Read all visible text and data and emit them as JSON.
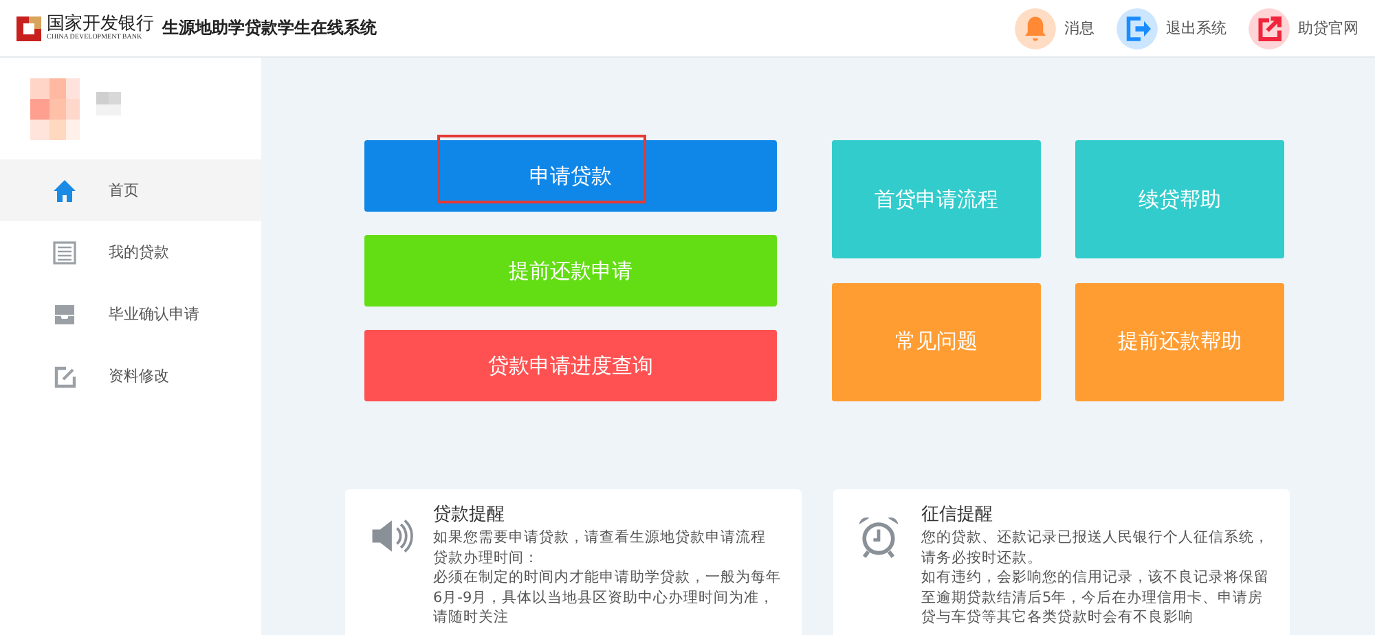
{
  "header": {
    "bank_name": "国家开发银行",
    "bank_name_en": "CHINA DEVELOPMENT BANK",
    "system_title": "生源地助学贷款学生在线系统",
    "actions": [
      {
        "kind": "bell",
        "label": "消息"
      },
      {
        "kind": "logout",
        "label": "退出系统"
      },
      {
        "kind": "external",
        "label": "助贷官网"
      }
    ]
  },
  "sidebar": {
    "items": [
      {
        "kind": "home",
        "label": "首页",
        "selected": true
      },
      {
        "kind": "list",
        "label": "我的贷款",
        "selected": false
      },
      {
        "kind": "inbox",
        "label": "毕业确认申请",
        "selected": false
      },
      {
        "kind": "edit",
        "label": "资料修改",
        "selected": false
      }
    ]
  },
  "actions": [
    {
      "label": "申请贷款",
      "color": "#0f87e8",
      "highlighted": true
    },
    {
      "label": "提前还款申请",
      "color": "#63dd14",
      "highlighted": false
    },
    {
      "label": "贷款申请进度查询",
      "color": "#ff5151",
      "highlighted": false
    }
  ],
  "help_tiles": [
    {
      "label": "首贷申请流程",
      "color": "#33cccc"
    },
    {
      "label": "续贷帮助",
      "color": "#33cccc"
    },
    {
      "label": "常见问题",
      "color": "#ff9d33"
    },
    {
      "label": "提前还款帮助",
      "color": "#ff9d33"
    }
  ],
  "notices": [
    {
      "kind": "speaker",
      "title": "贷款提醒",
      "lines": [
        "如果您需要申请贷款，请查看生源地贷款申请流程",
        "贷款办理时间：",
        "必须在制定的时间内才能申请助学贷款，一般为每年6月-9月，具体以当地县区资助中心办理时间为准，请随时关注"
      ]
    },
    {
      "kind": "clock",
      "title": "征信提醒",
      "lines": [
        "您的贷款、还款记录已报送人民银行个人征信系统，请务必按时还款。",
        "如有违约，会影响您的信用记录，该不良记录将保留至逾期贷款结清后5年，今后在办理信用卡、申请房贷与车贷等其它各类贷款时会有不良影响"
      ]
    }
  ]
}
